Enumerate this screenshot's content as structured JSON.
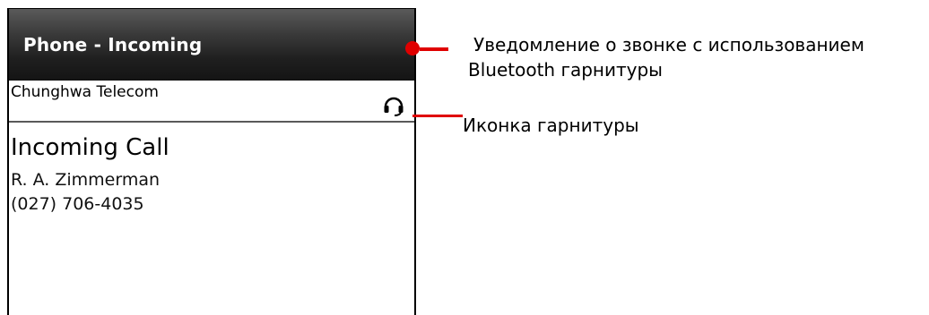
{
  "window": {
    "title": "Phone - Incoming"
  },
  "status": {
    "carrier": "Chunghwa Telecom",
    "headset_icon": "headset-icon"
  },
  "call": {
    "heading": "Incoming Call",
    "caller_name": "R. A. Zimmerman",
    "caller_number": "(027) 706-4035"
  },
  "annotations": {
    "notification_line1": "Уведомление о звонке с использованием",
    "notification_line2": "Bluetooth гарнитуры",
    "headset_label": "Иконка гарнитуры",
    "accent_color": "#e00000"
  }
}
